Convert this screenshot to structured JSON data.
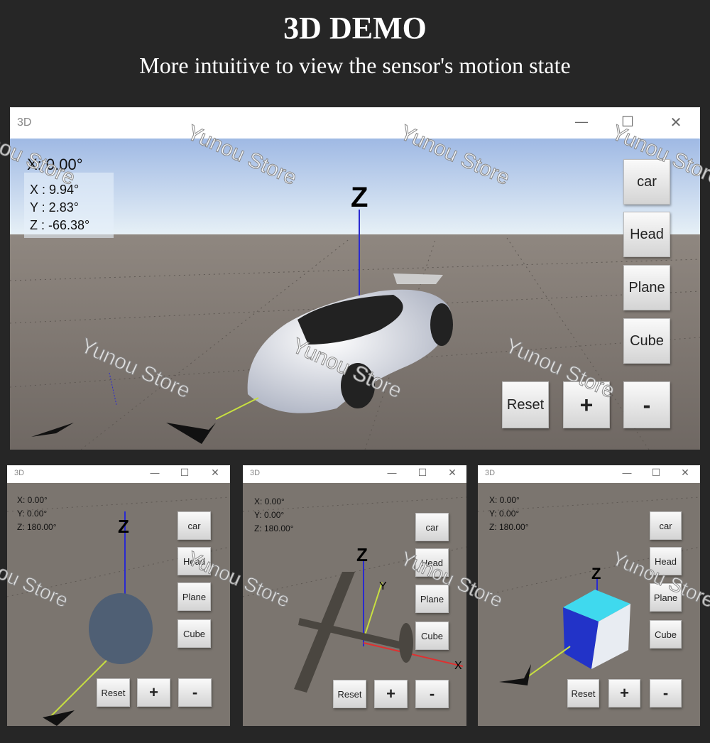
{
  "header": {
    "title": "3D DEMO",
    "subtitle": "More intuitive to view the sensor's motion state"
  },
  "watermark": "Yunou Store",
  "main": {
    "title": "3D",
    "controls": {
      "minimize": "—",
      "maximize": "☐",
      "close": "✕"
    },
    "readout": {
      "x_top": "X: 0.00°",
      "x": "X : 9.94°",
      "y": "Y : 2.83°",
      "z": "Z : -66.38°"
    },
    "axis_label": "Z",
    "model": "car",
    "buttons": {
      "car": "car",
      "head": "Head",
      "plane": "Plane",
      "cube": "Cube",
      "reset": "Reset",
      "plus": "+",
      "minus": "-"
    }
  },
  "small": [
    {
      "title": "3D",
      "model": "head",
      "readout": {
        "x": "X:  0.00°",
        "y": "Y:  0.00°",
        "z": "Z:  180.00°"
      },
      "axis_label": "Z"
    },
    {
      "title": "3D",
      "model": "plane",
      "readout": {
        "x": "X:  0.00°",
        "y": "Y:  0.00°",
        "z": "Z:  180.00°"
      },
      "axis_label": "Z",
      "axis_y": "Y",
      "axis_x": "X"
    },
    {
      "title": "3D",
      "model": "cube",
      "readout": {
        "x": "X:  0.00°",
        "y": "Y:  0.00°",
        "z": "Z:  180.00°"
      },
      "axis_label": "Z"
    }
  ],
  "small_controls": {
    "minimize": "—",
    "maximize": "☐",
    "close": "✕"
  },
  "small_buttons": {
    "car": "car",
    "head": "Head",
    "plane": "Plane",
    "cube": "Cube",
    "reset": "Reset",
    "plus": "+",
    "minus": "-"
  },
  "colors": {
    "cube_face": "#3fd9ee",
    "cube_side": "#2233c8",
    "axis_z": "#2a2ad0",
    "axis_y": "#c8e040",
    "axis_x": "#e03030"
  }
}
